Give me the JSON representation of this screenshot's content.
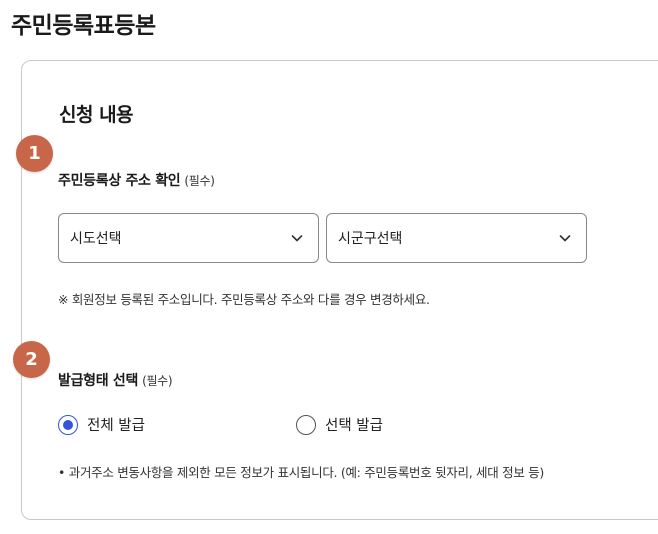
{
  "page": {
    "title": "주민등록표등본"
  },
  "form": {
    "section_title": "신청 내용",
    "steps": [
      {
        "number": "1"
      },
      {
        "number": "2"
      }
    ],
    "address": {
      "label": "주민등록상 주소 확인",
      "required": "(필수)",
      "sido_select": {
        "selected": "시도선택",
        "icon": "chevron-down-icon"
      },
      "sigungu_select": {
        "selected": "시군구선택",
        "icon": "chevron-down-icon"
      },
      "note": "※ 회원정보 등록된 주소입니다. 주민등록상 주소와 다를 경우 변경하세요."
    },
    "issue_type": {
      "label": "발급형태 선택",
      "required": "(필수)",
      "options": [
        {
          "label": "전체 발급",
          "checked": true
        },
        {
          "label": "선택 발급",
          "checked": false
        }
      ],
      "note": "• 과거주소 변동사항을 제외한 모든 정보가 표시됩니다. (예: 주민등록번호 뒷자리, 세대 정보 등)"
    }
  },
  "colors": {
    "badge": "#c8664a",
    "radio_accent": "#3553d9",
    "border": "#c9c9c9"
  }
}
